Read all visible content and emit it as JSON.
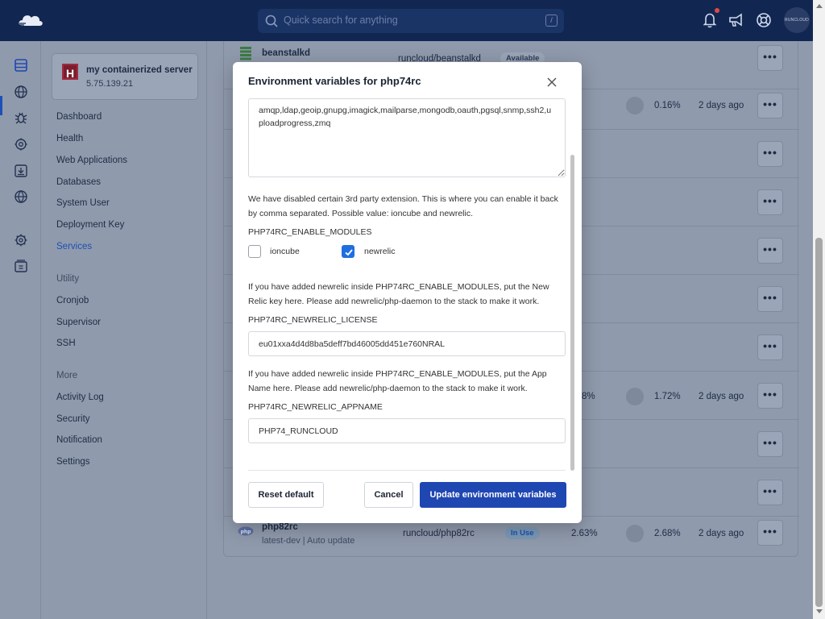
{
  "header": {
    "search_placeholder": "Quick search for anything",
    "search_shortcut": "/",
    "avatar_text": "RUNCLOUD"
  },
  "server": {
    "initial": "H",
    "name": "my containerized server",
    "ip": "5.75.139.21"
  },
  "sidebar": {
    "items": [
      "Dashboard",
      "Health",
      "Web Applications",
      "Databases",
      "System User",
      "Deployment Key",
      "Services"
    ],
    "active": "Services",
    "utility_heading": "Utility",
    "utility_items": [
      "Cronjob",
      "Supervisor",
      "SSH"
    ],
    "more_heading": "More",
    "more_items": [
      "Activity Log",
      "Security",
      "Notification",
      "Settings"
    ]
  },
  "list": {
    "top_row": {
      "name": "beanstalkd",
      "image": "runcloud/beanstalkd",
      "status": "Available"
    },
    "row2": {
      "mem": "0.16%",
      "updated": "2 days ago"
    },
    "row8": {
      "cpu": "8%",
      "mem": "1.72%",
      "updated": "2 days ago"
    },
    "bottom_row": {
      "name": "php82rc",
      "sub": "latest-dev | Auto update",
      "image": "runcloud/php82rc",
      "status": "In Use",
      "cpu": "2.63%",
      "mem": "2.68%",
      "updated": "2 days ago"
    },
    "more_glyph": "•••"
  },
  "modal": {
    "title": "Environment variables for php74rc",
    "extensions_value": "amqp,ldap,geoip,gnupg,imagick,mailparse,mongodb,oauth,pgsql,snmp,ssh2,uploadprogress,zmq",
    "enable_help": "We have disabled certain 3rd party extension. This is where you can enable it back by comma separated. Possible value: ioncube and newrelic.",
    "enable_label": "PHP74RC_ENABLE_MODULES",
    "option_ioncube": "ioncube",
    "option_newrelic": "newrelic",
    "ioncube_checked": false,
    "newrelic_checked": true,
    "license_help": "If you have added newrelic inside PHP74RC_ENABLE_MODULES, put the New Relic key here. Please add newrelic/php-daemon to the stack to make it work.",
    "license_label": "PHP74RC_NEWRELIC_LICENSE",
    "license_value": "eu01xxa4d4d8ba5deff7bd46005dd451e760NRAL",
    "appname_help": "If you have added newrelic inside PHP74RC_ENABLE_MODULES, put the App Name here. Please add newrelic/php-daemon to the stack to make it work.",
    "appname_label": "PHP74RC_NEWRELIC_APPNAME",
    "appname_value": "PHP74_RUNCLOUD",
    "reset_label": "Reset default",
    "cancel_label": "Cancel",
    "update_label": "Update environment variables"
  },
  "colors": {
    "primary": "#1f47b2",
    "checkbox": "#1f6fe0",
    "topbar": "#112752",
    "active_nav": "#1e4fb6"
  }
}
